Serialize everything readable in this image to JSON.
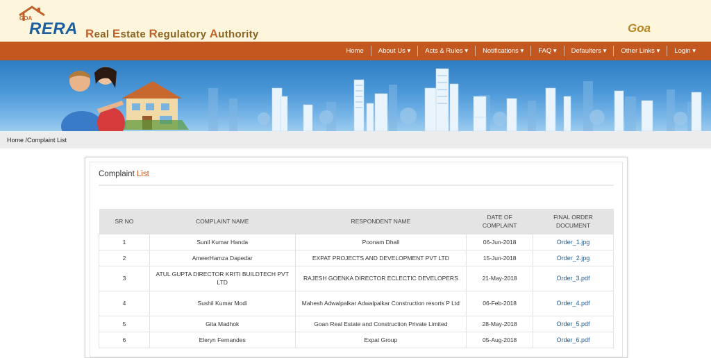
{
  "header": {
    "logo_small": "GOA",
    "logo_main": "RERA",
    "authority": {
      "w1_cap": "R",
      "w1_rest": "eal ",
      "w2_cap": "E",
      "w2_rest": "state ",
      "w3_cap": "R",
      "w3_rest": "egulatory ",
      "w4_cap": "A",
      "w4_rest": "uthority"
    },
    "state": "Goa"
  },
  "nav": {
    "items": [
      "Home",
      "About Us ▾",
      "Acts & Rules ▾",
      "Notifications ▾",
      "FAQ ▾",
      "Defaulters ▾",
      "Other Links ▾",
      "Login ▾"
    ]
  },
  "breadcrumb": "Home /Complaint List",
  "complaint": {
    "title_main": "Complaint ",
    "title_accent": "List",
    "headers": {
      "sr_no": "SR NO",
      "complaint_name": "COMPLAINT NAME",
      "respondent_name": "RESPONDENT NAME",
      "date_1": "DATE OF",
      "date_2": "COMPLAINT",
      "final_1": "FINAL ORDER",
      "final_2": "DOCUMENT"
    },
    "rows": [
      {
        "sr": "1",
        "complainant": "Sunil Kumar Handa",
        "respondent": "Poonam Dhall",
        "date": "06-Jun-2018",
        "doc": "Order_1.jpg"
      },
      {
        "sr": "2",
        "complainant": "AmeerHamza Dapedar",
        "respondent": "EXPAT PROJECTS AND DEVELOPMENT PVT LTD",
        "date": "15-Jun-2018",
        "doc": "Order_2.jpg"
      },
      {
        "sr": "3",
        "complainant": "ATUL GUPTA DIRECTOR KRITI BUILDTECH PVT LTD",
        "respondent": "RAJESH GOENKA DIRECTOR ECLECTIC DEVELOPERS",
        "date": "21-May-2018",
        "doc": "Order_3.pdf"
      },
      {
        "sr": "4",
        "complainant": "Sushil Kumar Modi",
        "respondent": "Mahesh Adwalpalkar Adwalpalkar Construction resorts P Ltd",
        "date": "06-Feb-2018",
        "doc": "Order_4.pdf"
      },
      {
        "sr": "5",
        "complainant": "Gita Madhok",
        "respondent": "Goan Real Estate and Construction Private Limited",
        "date": "28-May-2018",
        "doc": "Order_5.pdf"
      },
      {
        "sr": "6",
        "complainant": "Eleryn Fernandes",
        "respondent": "Expat Group",
        "date": "05-Aug-2018",
        "doc": "Order_6.pdf"
      }
    ]
  },
  "colors": {
    "nav_bg": "#c2581f",
    "header_bg": "#fdf6dc",
    "rera_blue": "#1d5ea0",
    "accent_orange": "#c2581f",
    "link_blue": "#1f5a93"
  },
  "icons": {
    "logo": "house-roof-icon",
    "banner": "city-skyline-illustration"
  }
}
